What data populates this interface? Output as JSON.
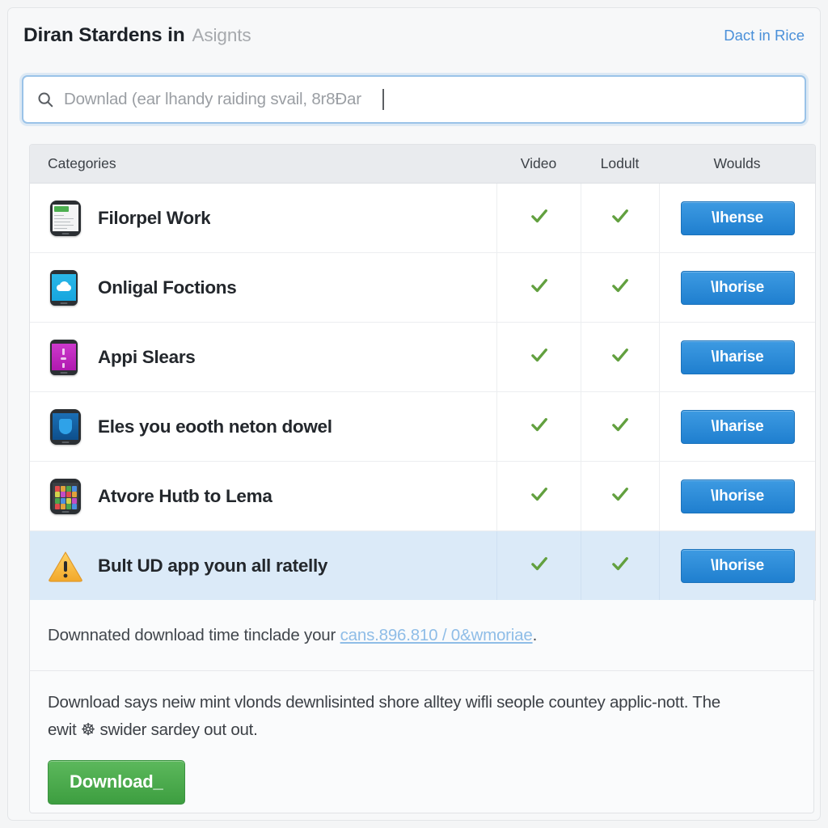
{
  "header": {
    "title_main": "Diran Stardens in",
    "title_sub": "Asignts",
    "link": "Dact in Rice"
  },
  "search": {
    "icon": "search-icon",
    "placeholder": "Downlad (ear lhandy raiding svail, 8r8Ðar",
    "value": ""
  },
  "table": {
    "columns": [
      "Categories",
      "Video",
      "Lodult",
      "Woulds"
    ],
    "rows": [
      {
        "icon": "device-document-icon",
        "label": "Filorpel Work",
        "video": "check",
        "adult": "check",
        "action": "\\Ihense"
      },
      {
        "icon": "device-cloud-icon",
        "label": "Onligal Foctions",
        "video": "check",
        "adult": "check",
        "action": "\\Ihorise"
      },
      {
        "icon": "device-pink-icon",
        "label": "Appi Slears",
        "video": "check",
        "adult": "check",
        "action": "\\Iharise"
      },
      {
        "icon": "device-shield-icon",
        "label": "Eles you eooth neton dowel",
        "video": "check",
        "adult": "check",
        "action": "\\Iharise"
      },
      {
        "icon": "device-apps-icon",
        "label": "Atvore Hutb to Lema",
        "video": "check",
        "adult": "check",
        "action": "\\Ihorise"
      },
      {
        "icon": "warning-triangle-icon",
        "label": "Bult UD app youn all ratelly",
        "video": "check",
        "adult": "check",
        "action": "\\Ihorise",
        "highlight": true
      }
    ]
  },
  "notes": {
    "note1_pre": "Downnated download time tinclade your ",
    "note1_link": "cans.896.810 / 0&wmoriae",
    "note1_post": ".",
    "note2_line1": "Download says neiw mint vlonds dewnlisinted shore alltey wifli seople countey applic-nott. The",
    "note2_line2": "ewit ☸ swider sardey out out.",
    "download_button": "Download_"
  },
  "colors": {
    "accent_blue": "#3d9ae2",
    "link_blue": "#4a90d9",
    "check_green": "#62a03f",
    "download_green": "#4caf50",
    "highlight_row": "#dbeaf8",
    "header_bg": "#e9ebee"
  }
}
